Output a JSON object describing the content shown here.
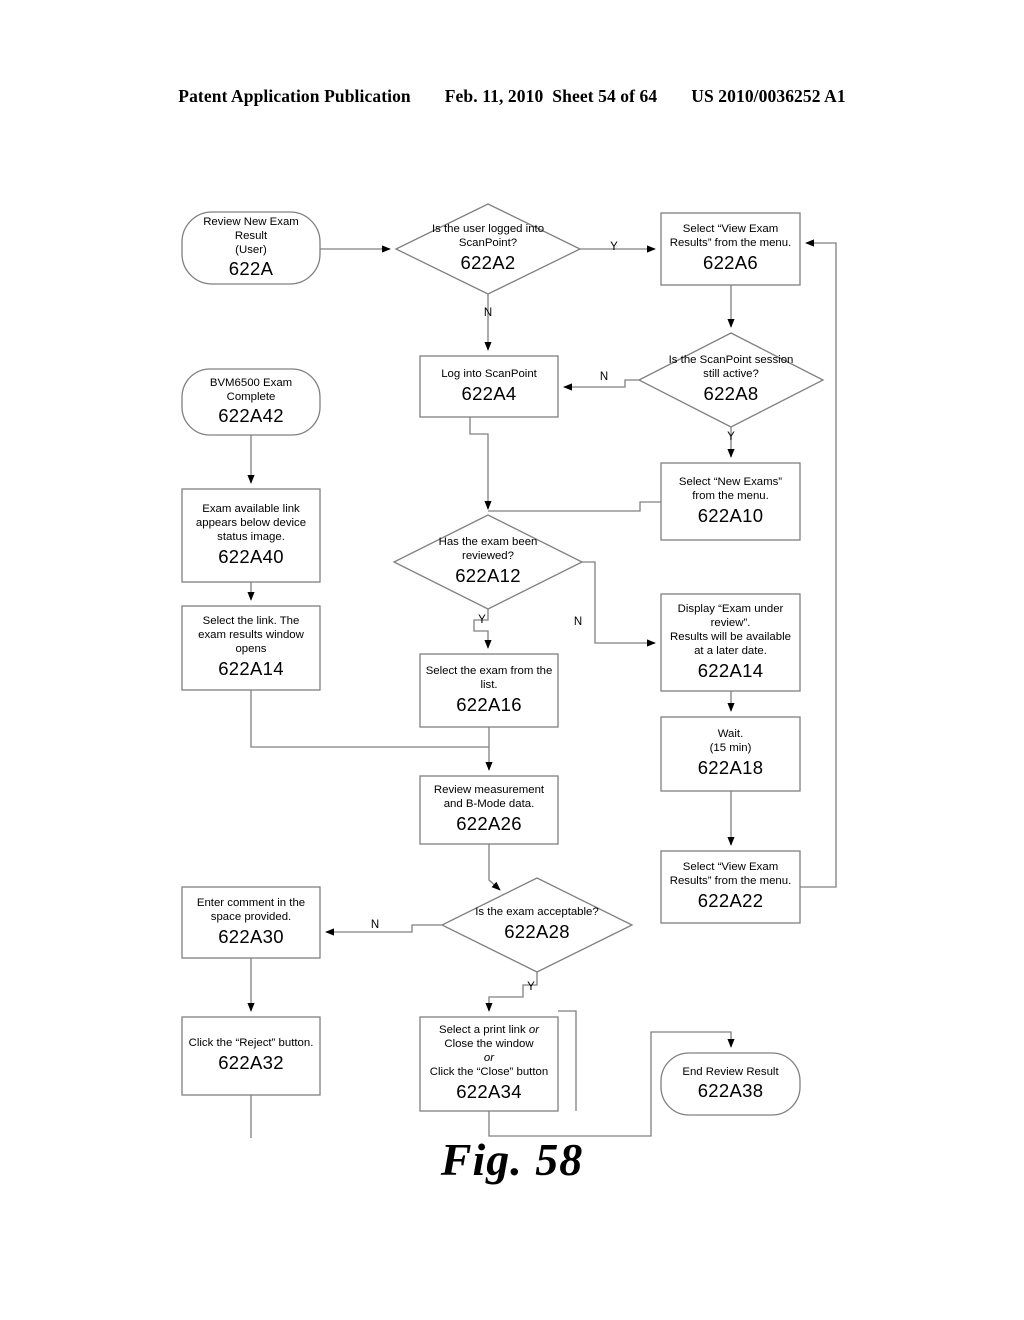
{
  "header": {
    "publication": "Patent Application Publication",
    "date": "Feb. 11, 2010",
    "sheet": "Sheet 54 of 64",
    "patent_number": "US 2010/0036252 A1"
  },
  "figure": {
    "caption": "Fig. 58",
    "line_color": "#808080",
    "text_color": "#000000"
  },
  "nodes": {
    "n622A": {
      "shape": "terminator",
      "text": "Review New Exam\nResult\n(User)",
      "ref": "622A"
    },
    "n622A2": {
      "shape": "decision",
      "text": "Is the user logged into\nScanPoint?",
      "ref": "622A2"
    },
    "n622A6": {
      "shape": "process",
      "text": "Select “View Exam\nResults” from the menu.",
      "ref": "622A6"
    },
    "n622A8": {
      "shape": "decision",
      "text": "Is the ScanPoint session\nstill active?",
      "ref": "622A8"
    },
    "n622A4": {
      "shape": "process",
      "text": "Log into ScanPoint",
      "ref": "622A4"
    },
    "n622A42": {
      "shape": "terminator",
      "text": "BVM6500 Exam\nComplete",
      "ref": "622A42"
    },
    "n622A10": {
      "shape": "process",
      "text": "Select “New Exams”\nfrom the menu.",
      "ref": "622A10"
    },
    "n622A40": {
      "shape": "process",
      "text": "Exam available link\nappears below device\nstatus image.",
      "ref": "622A40"
    },
    "n622A12": {
      "shape": "decision",
      "text": "Has the exam been\nreviewed?",
      "ref": "622A12"
    },
    "n622A14L": {
      "shape": "process",
      "text": "Select the link. The\nexam results window\nopens",
      "ref": "622A14"
    },
    "n622A14R": {
      "shape": "process",
      "text": "Display “Exam under\nreview”.\nResults will be available\nat a later date.",
      "ref": "622A14"
    },
    "n622A16": {
      "shape": "process",
      "text": "Select the exam from the\nlist.",
      "ref": "622A16"
    },
    "n622A18": {
      "shape": "process",
      "text": "Wait.\n(15 min)",
      "ref": "622A18"
    },
    "n622A26": {
      "shape": "process",
      "text": "Review measurement\nand B-Mode data.",
      "ref": "622A26"
    },
    "n622A22": {
      "shape": "process",
      "text": "Select “View Exam\nResults” from the menu.",
      "ref": "622A22"
    },
    "n622A28": {
      "shape": "decision",
      "text": "Is the exam acceptable?",
      "ref": "622A28"
    },
    "n622A30": {
      "shape": "process",
      "text": "Enter comment in the\nspace provided.",
      "ref": "622A30"
    },
    "n622A32": {
      "shape": "process",
      "text": "Click the “Reject” button.",
      "ref": "622A32"
    },
    "n622A34": {
      "shape": "process",
      "text_parts": [
        "Select a print link ",
        "or",
        "\nClose the window\n",
        "or",
        "\nClick the “Close” button"
      ],
      "ref": "622A34"
    },
    "n622A38": {
      "shape": "terminator",
      "text": "End Review Result",
      "ref": "622A38"
    }
  },
  "edge_labels": {
    "a2_yes": "Y",
    "a2_no": "N",
    "a8_no": "N",
    "a8_yes": "Y",
    "a12_yes": "Y",
    "a12_no": "N",
    "a28_no": "N",
    "a28_yes": "Y"
  }
}
